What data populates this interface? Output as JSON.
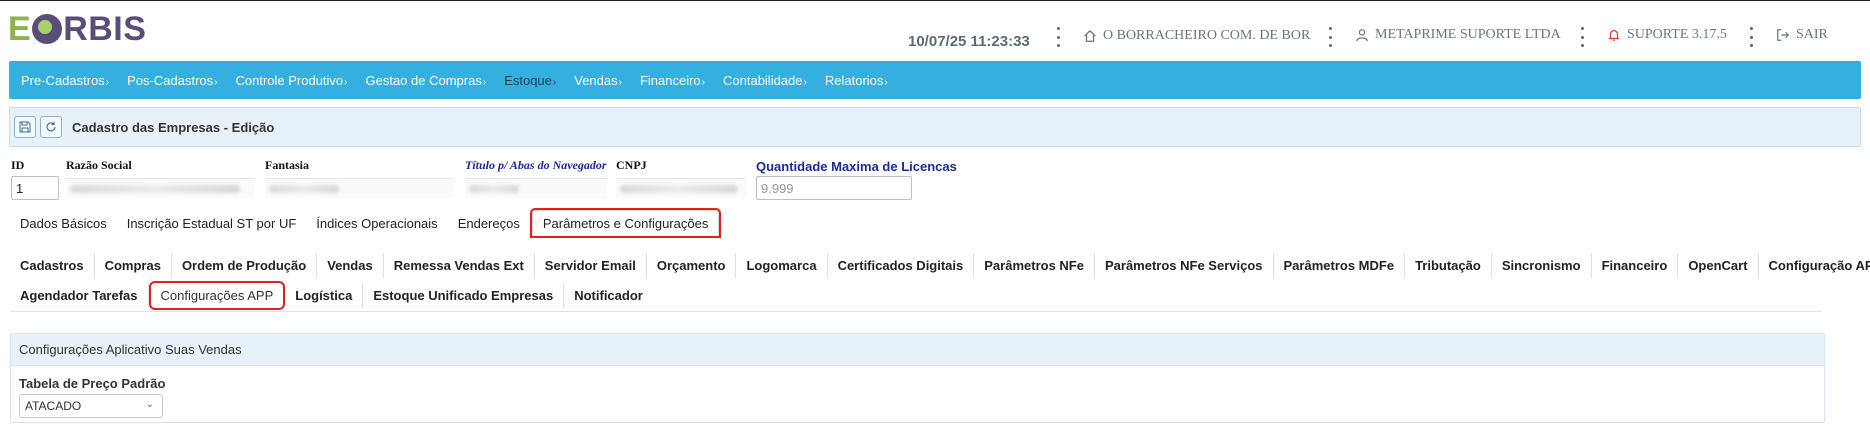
{
  "app": {
    "logo_e": "E",
    "logo_rest": "BIS",
    "logo_r": "R"
  },
  "header": {
    "datetime": "10/07/25 11:23:33",
    "company": "O BORRACHEIRO COM. DE BOR",
    "user_company": "METAPRIME SUPORTE LTDA",
    "version": "SUPORTE 3.17.5",
    "logout": "SAIR",
    "icons": [
      "home-icon",
      "user-icon",
      "bell-icon",
      "logout-icon"
    ]
  },
  "nav": {
    "items": [
      {
        "label": "Pre-Cadastros",
        "caret": "›"
      },
      {
        "label": "Pos-Cadastros",
        "caret": "›"
      },
      {
        "label": "Controle Produtivo",
        "caret": "›"
      },
      {
        "label": "Gestao de Compras",
        "caret": "›"
      },
      {
        "label": "Estoque",
        "caret": "›"
      },
      {
        "label": "Vendas",
        "caret": "›"
      },
      {
        "label": "Financeiro",
        "caret": "›"
      },
      {
        "label": "Contabilidade",
        "caret": "›"
      },
      {
        "label": "Relatorios",
        "caret": "›"
      }
    ],
    "active": "Estoque"
  },
  "page": {
    "title": "Cadastro das Empresas - Edição"
  },
  "fields": {
    "id_label": "ID",
    "id_value": "1",
    "razao_label": "Razão Social",
    "fantasia_label": "Fantasia",
    "titulo_label": "Título p/ Abas do Navegador",
    "cnpj_label": "CNPJ",
    "licencas_label": "Quantidade Maxima de Licencas",
    "licencas_placeholder": "9.999"
  },
  "tabs_top": [
    "Dados Básicos",
    "Inscrição Estadual ST por UF",
    "Índices Operacionais",
    "Endereços",
    "Parâmetros e Configurações"
  ],
  "tabs_top_selected": "Parâmetros e Configurações",
  "subtabs_row1": [
    "Cadastros",
    "Compras",
    "Ordem de Produção",
    "Vendas",
    "Remessa Vendas Ext",
    "Servidor Email",
    "Orçamento",
    "Logomarca",
    "Certificados Digitais",
    "Parâmetros NFe",
    "Parâmetros NFe Serviços",
    "Parâmetros MDFe",
    "Tributação",
    "Sincronismo",
    "Financeiro",
    "OpenCart",
    "Configuração API(s)"
  ],
  "subtabs_row2": [
    "Agendador Tarefas",
    "Configurações APP",
    "Logística",
    "Estoque Unificado Empresas",
    "Notificador"
  ],
  "subtab_selected": "Configurações APP",
  "panel": {
    "title": "Configurações Aplicativo Suas Vendas",
    "price_table_label": "Tabela de Preço Padrão",
    "price_table_value": "ATACADO"
  },
  "colors": {
    "nav_bg": "#35aee0",
    "highlight": "#e02020",
    "panel_bg": "#e6f1fa"
  }
}
